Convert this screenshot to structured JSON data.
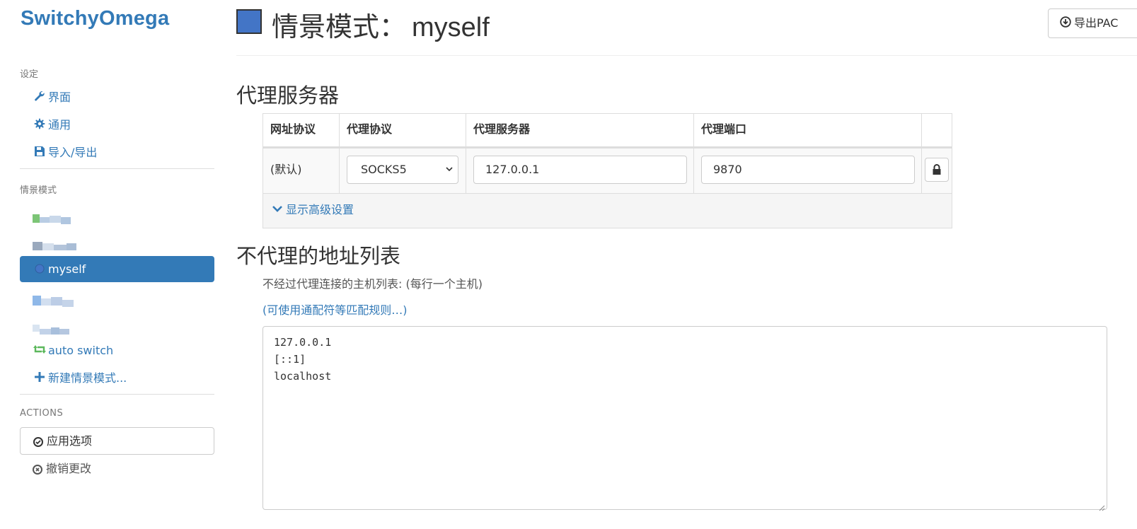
{
  "sidebar": {
    "brand": "SwitchyOmega",
    "settings_header": "设定",
    "settings_items": [
      {
        "label": "界面",
        "icon": "wrench-icon"
      },
      {
        "label": "通用",
        "icon": "gear-icon"
      },
      {
        "label": "导入/导出",
        "icon": "floppy-disk-icon"
      }
    ],
    "profiles_header": "情景模式",
    "profiles": [
      {
        "label": "myself",
        "icon": "globe-icon",
        "active": true
      },
      {
        "label": "auto switch",
        "icon": "retweet-icon"
      }
    ],
    "new_profile": "新建情景模式...",
    "actions_header": "ACTIONS",
    "apply": "应用选项",
    "revert": "撤销更改"
  },
  "header": {
    "title_prefix": "情景模式：",
    "profile_name": "myself",
    "export_label": "导出PAC",
    "profile_color": "#4375c6"
  },
  "proxy": {
    "section_title": "代理服务器",
    "columns": [
      "网址协议",
      "代理协议",
      "代理服务器",
      "代理端口",
      ""
    ],
    "row": {
      "scheme": "(默认)",
      "protocol": "SOCKS5",
      "server": "127.0.0.1",
      "port": "9870"
    },
    "advanced": "显示高级设置"
  },
  "bypass": {
    "section_title": "不代理的地址列表",
    "help": "不经过代理连接的主机列表: (每行一个主机)",
    "wildcard_link": "(可使用通配符等匹配规则…)",
    "list": "127.0.0.1\n[::1]\nlocalhost"
  },
  "colors": {
    "accent": "#337ab7",
    "autoswitch": "#5cb85c"
  }
}
